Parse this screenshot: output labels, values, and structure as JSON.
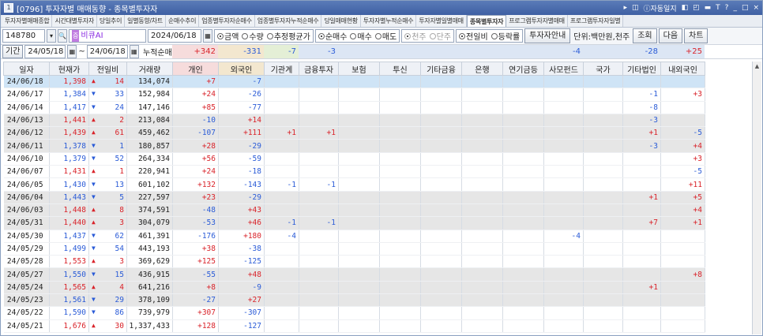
{
  "window": {
    "title": "[0796] 투자자별 매매동향 - 종목별투자자",
    "right_icons": [
      "▸",
      "◫",
      "자동일지",
      "◧",
      "◰",
      "▭",
      "T",
      "?",
      "_",
      "□",
      "×"
    ]
  },
  "tabs": [
    "투자자별매매종합",
    "시간대별투자자",
    "당일추이",
    "일별동향/차트",
    "순매수추이",
    "업종별투자자순매수",
    "업종별투자자누적순매수",
    "당일매매현황",
    "투자자별누적순매수",
    "투자자별일별매매",
    "종목별투자자",
    "프로그램투자자별매매",
    "프로그램투자자일별"
  ],
  "active_tab": 10,
  "controls": {
    "stock_code": "148780",
    "stock_name": "비큐AI",
    "date": "2024/06/18",
    "radio_amount": "금액",
    "radio_qty": "수량",
    "radio_avg": "추정평균가",
    "radio_net": "순매수",
    "radio_buy": "매수",
    "radio_sell": "매도",
    "radio_thousand": "천주",
    "radio_unit": "단주",
    "radio_prev": "전일비",
    "radio_rate": "등락률",
    "guide_btn": "투자자안내",
    "unit_label": "단위:백만원,천주",
    "query_btn": "조회",
    "next_btn": "다음",
    "chart_btn": "차트"
  },
  "period": {
    "label": "기간",
    "from": "24/05/18",
    "to": "24/06/18",
    "cum_label": "누적순매수"
  },
  "sums": [
    "+342",
    "-331",
    "-7",
    "-3",
    "",
    "",
    "",
    "",
    "",
    "-4",
    "",
    "-28",
    "+25"
  ],
  "columns": [
    "일자",
    "현재가",
    "전일비",
    "거래량",
    "개인",
    "외국인",
    "기관계",
    "금융투자",
    "보험",
    "투신",
    "기타금융",
    "은행",
    "연기금등",
    "사모펀드",
    "국가",
    "기타법인",
    "내외국인"
  ],
  "rows": [
    {
      "d": "24/06/18",
      "p": "1,398",
      "c": "14",
      "dir": "up",
      "v": "134,074",
      "i": "+7",
      "f": "-7",
      "o": [
        "",
        "",
        "",
        "",
        "",
        "",
        "",
        "",
        "",
        "",
        ""
      ]
    },
    {
      "d": "24/06/17",
      "p": "1,384",
      "c": "33",
      "dir": "dn",
      "v": "152,984",
      "i": "+24",
      "f": "-26",
      "o": [
        "",
        "",
        "",
        "",
        "",
        "",
        "",
        "",
        "",
        "-1",
        "+3"
      ]
    },
    {
      "d": "24/06/14",
      "p": "1,417",
      "c": "24",
      "dir": "dn",
      "v": "147,146",
      "i": "+85",
      "f": "-77",
      "o": [
        "",
        "",
        "",
        "",
        "",
        "",
        "",
        "",
        "",
        "-8",
        ""
      ]
    },
    {
      "d": "24/06/13",
      "p": "1,441",
      "c": "2",
      "dir": "up",
      "v": "213,084",
      "i": "-10",
      "f": "+14",
      "o": [
        "",
        "",
        "",
        "",
        "",
        "",
        "",
        "",
        "",
        "-3",
        ""
      ]
    },
    {
      "d": "24/06/12",
      "p": "1,439",
      "c": "61",
      "dir": "up",
      "v": "459,462",
      "i": "-107",
      "f": "+111",
      "o": [
        "+1",
        "+1",
        "",
        "",
        "",
        "",
        "",
        "",
        "",
        "+1",
        "-5"
      ]
    },
    {
      "d": "24/06/11",
      "p": "1,378",
      "c": "1",
      "dir": "dn",
      "v": "180,857",
      "i": "+28",
      "f": "-29",
      "o": [
        "",
        "",
        "",
        "",
        "",
        "",
        "",
        "",
        "",
        "-3",
        "+4"
      ]
    },
    {
      "d": "24/06/10",
      "p": "1,379",
      "c": "52",
      "dir": "dn",
      "v": "264,334",
      "i": "+56",
      "f": "-59",
      "o": [
        "",
        "",
        "",
        "",
        "",
        "",
        "",
        "",
        "",
        "",
        "+3"
      ]
    },
    {
      "d": "24/06/07",
      "p": "1,431",
      "c": "1",
      "dir": "up",
      "v": "220,941",
      "i": "+24",
      "f": "-18",
      "o": [
        "",
        "",
        "",
        "",
        "",
        "",
        "",
        "",
        "",
        "",
        "-5"
      ]
    },
    {
      "d": "24/06/05",
      "p": "1,430",
      "c": "13",
      "dir": "dn",
      "v": "601,102",
      "i": "+132",
      "f": "-143",
      "o": [
        "-1",
        "-1",
        "",
        "",
        "",
        "",
        "",
        "",
        "",
        "",
        "+11"
      ]
    },
    {
      "d": "24/06/04",
      "p": "1,443",
      "c": "5",
      "dir": "dn",
      "v": "227,597",
      "i": "+23",
      "f": "-29",
      "o": [
        "",
        "",
        "",
        "",
        "",
        "",
        "",
        "",
        "",
        "+1",
        "+5"
      ]
    },
    {
      "d": "24/06/03",
      "p": "1,448",
      "c": "8",
      "dir": "up",
      "v": "374,591",
      "i": "-48",
      "f": "+43",
      "o": [
        "",
        "",
        "",
        "",
        "",
        "",
        "",
        "",
        "",
        "",
        "+4"
      ]
    },
    {
      "d": "24/05/31",
      "p": "1,440",
      "c": "3",
      "dir": "up",
      "v": "304,079",
      "i": "-53",
      "f": "+46",
      "o": [
        "-1",
        "-1",
        "",
        "",
        "",
        "",
        "",
        "",
        "",
        "+7",
        "+1"
      ]
    },
    {
      "d": "24/05/30",
      "p": "1,437",
      "c": "62",
      "dir": "dn",
      "v": "461,391",
      "i": "-176",
      "f": "+180",
      "o": [
        "-4",
        "",
        "",
        "",
        "",
        "",
        "",
        "-4",
        "",
        "",
        ""
      ]
    },
    {
      "d": "24/05/29",
      "p": "1,499",
      "c": "54",
      "dir": "dn",
      "v": "443,193",
      "i": "+38",
      "f": "-38",
      "o": [
        "",
        "",
        "",
        "",
        "",
        "",
        "",
        "",
        "",
        "",
        ""
      ]
    },
    {
      "d": "24/05/28",
      "p": "1,553",
      "c": "3",
      "dir": "up",
      "v": "369,629",
      "i": "+125",
      "f": "-125",
      "o": [
        "",
        "",
        "",
        "",
        "",
        "",
        "",
        "",
        "",
        "",
        ""
      ]
    },
    {
      "d": "24/05/27",
      "p": "1,550",
      "c": "15",
      "dir": "dn",
      "v": "436,915",
      "i": "-55",
      "f": "+48",
      "o": [
        "",
        "",
        "",
        "",
        "",
        "",
        "",
        "",
        "",
        "",
        "+8"
      ]
    },
    {
      "d": "24/05/24",
      "p": "1,565",
      "c": "4",
      "dir": "up",
      "v": "641,216",
      "i": "+8",
      "f": "-9",
      "o": [
        "",
        "",
        "",
        "",
        "",
        "",
        "",
        "",
        "",
        "+1",
        ""
      ]
    },
    {
      "d": "24/05/23",
      "p": "1,561",
      "c": "29",
      "dir": "dn",
      "v": "378,109",
      "i": "-27",
      "f": "+27",
      "o": [
        "",
        "",
        "",
        "",
        "",
        "",
        "",
        "",
        "",
        "",
        ""
      ]
    },
    {
      "d": "24/05/22",
      "p": "1,590",
      "c": "86",
      "dir": "dn",
      "v": "739,979",
      "i": "+307",
      "f": "-307",
      "o": [
        "",
        "",
        "",
        "",
        "",
        "",
        "",
        "",
        "",
        "",
        ""
      ]
    },
    {
      "d": "24/05/21",
      "p": "1,676",
      "c": "30",
      "dir": "up",
      "v": "1,337,433",
      "i": "+128",
      "f": "-127",
      "o": [
        "",
        "",
        "",
        "",
        "",
        "",
        "",
        "",
        "",
        "",
        ""
      ]
    }
  ]
}
